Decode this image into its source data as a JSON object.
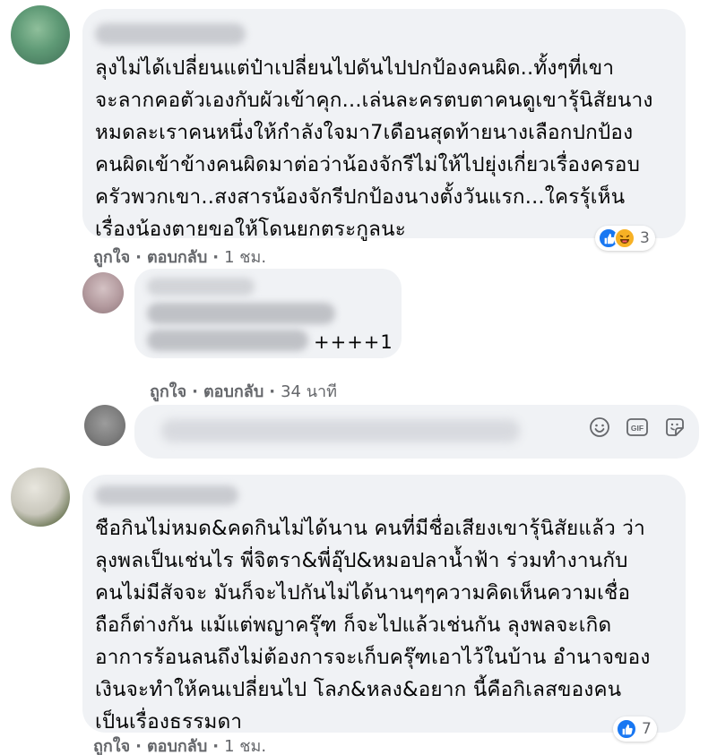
{
  "comments": [
    {
      "text": "ลุงไม่ได้เปลี่ยนแต่ป๋าเปลี่ยนไปดันไปปกป้องคนผิด..ทั้งๆที่เขา\nจะลากคอตัวเองกับผัวเข้าคุก...เล่นละครตบตาคนดูเขารุ้นิสัยนาง\nหมดละเราคนหนึ่งให้กำลังใจมา7เดือนสุดท้ายนางเลือกปกป้อง\nคนผิดเข้าข้างคนผิดมาต่อว่าน้องจักรีไม่ให้ไปยุ่งเกี่ยวเรื่องครอบ\nครัวพวกเขา..สงสารน้องจักรีปกป้องนางตั้งวันแรก...ใครรุ้เห็น\nเรื่องน้องตายขอให้โดนยกตระกูลนะ",
      "like": "ถูกใจ",
      "reply": "ตอบกลับ",
      "time": "1 ชม.",
      "reaction_count": "3"
    },
    {
      "visible_text": "++++1",
      "like": "ถูกใจ",
      "reply": "ตอบกลับ",
      "time": "34 นาที"
    },
    {
      "text": "ชือกินไม่หมด&คดกินไม่ได้นาน คนที่มีชื่อเสียงเขารุ้นิสัยแล้ว ว่า\nลุงพลเป็นเช่นไร พี่จิตรา&พี่อุ๊ป&หมอปลาน้ำฟ้า ร่วมทำงานกับ\nคนไม่มีสัจจะ มันก็จะไปกันไม่ได้นานๆๆความคิดเห็นความเชื่อ\nถือก็ต่างกัน แม้แต่พญาครุ๊ฑ ก็จะไปแล้วเช่นกัน ลุงพลจะเกิด\nอาการร้อนลนถึงไม่ต้องการจะเก็บครุ๊ฑเอาไว้ในบ้าน อำนาจของ\nเงินจะทำให้คนเปลี่ยนไป โลภ&หลง&อยาก นี้คือกิเลสของคน\nเป็นเรื่องธรรมดา",
      "like": "ถูกใจ",
      "reply": "ตอบกลับ",
      "time": "1 ชม.",
      "reaction_count": "7"
    }
  ],
  "composer": {
    "icons": [
      "emoji-icon",
      "gif-icon",
      "sticker-icon"
    ]
  },
  "colors": {
    "bubble": "#f0f2f5",
    "meta": "#65676b",
    "like_blue": "#1877f2",
    "haha_yellow": "#f7b125"
  }
}
